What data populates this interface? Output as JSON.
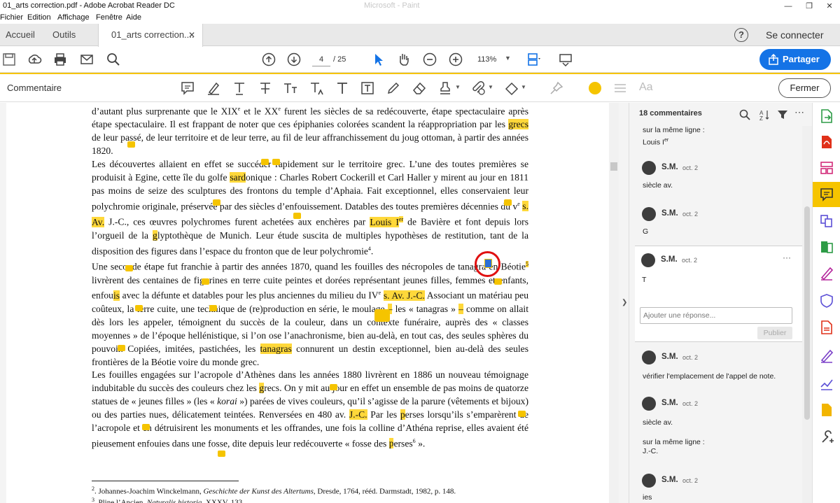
{
  "window": {
    "title": "01_arts correction.pdf - Adobe Acrobat Reader DC",
    "ghost_title": "Microsoft - Paint"
  },
  "menu": [
    "Fichier",
    "Edition",
    "Affichage",
    "Fenêtre",
    "Aide"
  ],
  "tabs": {
    "home": "Accueil",
    "tools": "Outils",
    "document": "01_arts correction....",
    "help": "?",
    "connect": "Se connecter"
  },
  "toolbar": {
    "current_page": "4",
    "page_separator": "/ 25",
    "zoom": "113%",
    "share_label": "Partager"
  },
  "comment_toolbar": {
    "label": "Commentaire",
    "font_label": "Aa",
    "close_label": "Fermer",
    "highlight_color": "#f5c400"
  },
  "document": {
    "paragraphs": [
      [
        {
          "t": "d’autant plus surprenante que le XIX"
        },
        {
          "t": "e",
          "sup": true
        },
        {
          "t": " et le XX"
        },
        {
          "t": "e",
          "sup": true
        },
        {
          "t": " furent les siècles de sa redécouverte, étape spectaculaire après étape spectaculaire. Il est frappant de noter que ces épiphanies colorées scandent la réappropriation par les "
        },
        {
          "t": "grecs",
          "hl": true
        },
        {
          "t": " de leur passé, de leur territoire et de leur terre, au fil de leur affranchissement du joug ottoman, à partir des années 1820."
        }
      ],
      [
        {
          "t": "Les découvertes allaient en effet se succéder rapidement sur le territoire grec. L’une des toutes premières se produisit à Egine, cette île du golfe "
        },
        {
          "t": "sard",
          "hl": true
        },
        {
          "t": "onique : Charles Robert Cockerill et Carl Haller y mirent au jour en 1811 pas moins de seize des sculptures des frontons du temple d’Aphaia. Fait exceptionnel, elles conservaient leur polychromie originale, préservée par des siècles d’enfouissement. Datables des toutes premières décennies du v"
        },
        {
          "t": "e",
          "sup": true
        },
        {
          "t": " "
        },
        {
          "t": "s. Av.",
          "hl": true
        },
        {
          "t": " J.-C., ces œuvres polychromes furent achetées aux enchères par "
        },
        {
          "t": "Louis I",
          "hl": true
        },
        {
          "t": "er",
          "sup": true,
          "hl": true
        },
        {
          "t": " de Bavière et font depuis lors l’orgueil de la "
        },
        {
          "t": "g",
          "hl": true
        },
        {
          "t": "lyptothèque de Munich. Leur étude suscita de multiples hypothèses de restitution, tant de la disposition des figures dans l’espace du fronton que de leur polychromie"
        },
        {
          "t": "4",
          "sup": true
        },
        {
          "t": "."
        }
      ],
      [
        {
          "t": "Une seconde étape fut franchie à partir des années 1870, quand les fouilles des nécropoles de tanagra en Béotie"
        },
        {
          "t": "5",
          "sup": true,
          "hl": true
        },
        {
          "t": " livrèrent des centaines de figurines en terre cuite peintes et dorées représentant jeunes filles, femmes et enfants, enfou"
        },
        {
          "t": "is",
          "hl": true
        },
        {
          "t": " avec la défunte et datables pour les plus anciennes du milieu du IV"
        },
        {
          "t": "e",
          "sup": true
        },
        {
          "t": " "
        },
        {
          "t": "s. Av. J.-C.",
          "hl": true
        },
        {
          "t": " Associant un matériau peu coûteux, la terre cuite, une technique de (re)production en série, le moulage "
        },
        {
          "t": "–",
          "hl": true
        },
        {
          "t": " les « tanagras » "
        },
        {
          "t": "–",
          "hl": true
        },
        {
          "t": " comme on allait dès lors les appeler, témoignent du succès de la couleur, dans un contexte funéraire, auprès des « classes moyennes » de l’époque hellénistique, si l’on ose l’anachronisme, bien au-delà, en tout cas, des seules sphères du pouvoir. Copiées, imitées, pastichées, les "
        },
        {
          "t": "tanagras",
          "hl": true
        },
        {
          "t": " connurent un destin exceptionnel, bien au-delà des seules frontières de la Béotie voire du monde grec."
        }
      ],
      [
        {
          "t": "Les fouilles engagées sur l’acropole d’Athènes dans les années 1880 livrèrent en 1886 un nouveau témoignage indubitable du succès des couleurs chez les "
        },
        {
          "t": "g",
          "hl": true
        },
        {
          "t": "recs. On y mit au jour en effet un ensemble de pas moins de quatorze statues de « jeunes filles » (les « "
        },
        {
          "t": "korai",
          "it": true
        },
        {
          "t": " ») parées de vives couleurs, qu’il s’agisse de la parure (vêtements et bijoux) ou des parties nues, délicatement teintées. Renversées en 480 av. "
        },
        {
          "t": "J.-C.",
          "hl": true
        },
        {
          "t": " Par les "
        },
        {
          "t": "p",
          "hl": true
        },
        {
          "t": "erses lorsqu’ils s’emparèrent de l’acropole et en détruisirent les monuments et les offrandes, une fois la colline d’Athéna reprise, elles avaient été pieusement enfouies dans une fosse, dite depuis leur redécouverte « fosse des "
        },
        {
          "t": "p",
          "hl": true
        },
        {
          "t": "erses"
        },
        {
          "t": "6",
          "sup": true
        },
        {
          "t": " »."
        }
      ]
    ],
    "footnotes": [
      [
        {
          "t": "2",
          "sup": true
        },
        {
          "t": ". Johannes-Joachim Winckelmann, "
        },
        {
          "t": "Geschichte der Kunst des Altertums",
          "it": true
        },
        {
          "t": ", Dresde, 1764, rééd. Darmstadt, 1982, p. 148."
        }
      ],
      [
        {
          "t": "3",
          "sup": true
        },
        {
          "t": ". Pline l’Ancien, "
        },
        {
          "t": "Naturalis historia",
          "it": true
        },
        {
          "t": ", XXXV, 133."
        }
      ]
    ]
  },
  "comments_panel": {
    "count_label": "18 commentaires",
    "first_partial": {
      "line1": "sur la même ligne :",
      "line2": "Louis I",
      "line2_sup": "er"
    },
    "items": [
      {
        "author": "S.M.",
        "date": "oct. 2",
        "text": "siècle av."
      },
      {
        "author": "S.M.",
        "date": "oct. 2",
        "text": "G"
      },
      {
        "author": "S.M.",
        "date": "oct. 2",
        "text": "T",
        "more": "···"
      },
      {
        "author": "S.M.",
        "date": "oct. 2",
        "text": "vérifier l'emplacement de l'appel de note."
      },
      {
        "author": "S.M.",
        "date": "oct. 2",
        "text": "siècle av.",
        "extra1": "sur la même ligne :",
        "extra2": "J.-C."
      },
      {
        "author": "S.M.",
        "date": "oct. 2",
        "text": "ies"
      }
    ],
    "reply_placeholder": "Ajouter une réponse...",
    "publish_label": "Publier"
  }
}
